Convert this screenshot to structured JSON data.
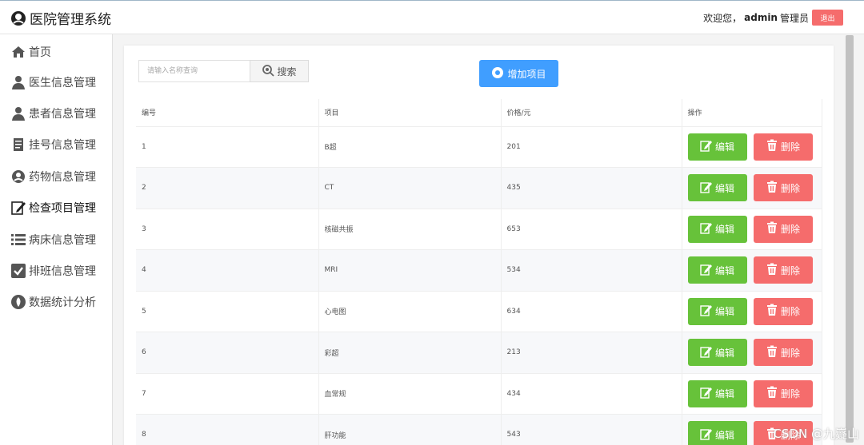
{
  "app": {
    "title": "医院管理系统"
  },
  "user": {
    "welcome": "欢迎您，",
    "name": "admin",
    "role": "管理员",
    "logout": "退出"
  },
  "sidebar": {
    "items": [
      {
        "label": "首页",
        "icon": "home-icon"
      },
      {
        "label": "医生信息管理",
        "icon": "doctor-icon"
      },
      {
        "label": "患者信息管理",
        "icon": "patient-icon"
      },
      {
        "label": "挂号信息管理",
        "icon": "document-icon"
      },
      {
        "label": "药物信息管理",
        "icon": "medicine-icon"
      },
      {
        "label": "检查项目管理",
        "icon": "edit-icon",
        "active": true
      },
      {
        "label": "病床信息管理",
        "icon": "list-icon"
      },
      {
        "label": "排班信息管理",
        "icon": "checkbox-icon"
      },
      {
        "label": "数据统计分析",
        "icon": "chart-icon"
      }
    ]
  },
  "search": {
    "placeholder": "请输入名称查询",
    "button": "搜索"
  },
  "toolbar": {
    "add_label": "增加项目"
  },
  "table": {
    "headers": [
      "编号",
      "项目",
      "价格/元",
      "操作"
    ],
    "rows": [
      {
        "id": "1",
        "name": "B超",
        "price": "201"
      },
      {
        "id": "2",
        "name": "CT",
        "price": "435"
      },
      {
        "id": "3",
        "name": "核磁共振",
        "price": "653"
      },
      {
        "id": "4",
        "name": "MRI",
        "price": "534"
      },
      {
        "id": "5",
        "name": "心电图",
        "price": "634"
      },
      {
        "id": "6",
        "name": "彩超",
        "price": "213"
      },
      {
        "id": "7",
        "name": "血常规",
        "price": "434"
      },
      {
        "id": "8",
        "name": "肝功能",
        "price": "543"
      }
    ],
    "edit_label": "编辑",
    "delete_label": "删除"
  },
  "watermark": "CSDN @九嶷山",
  "colors": {
    "primary": "#409eff",
    "success": "#67c23a",
    "danger": "#f56c6c"
  }
}
